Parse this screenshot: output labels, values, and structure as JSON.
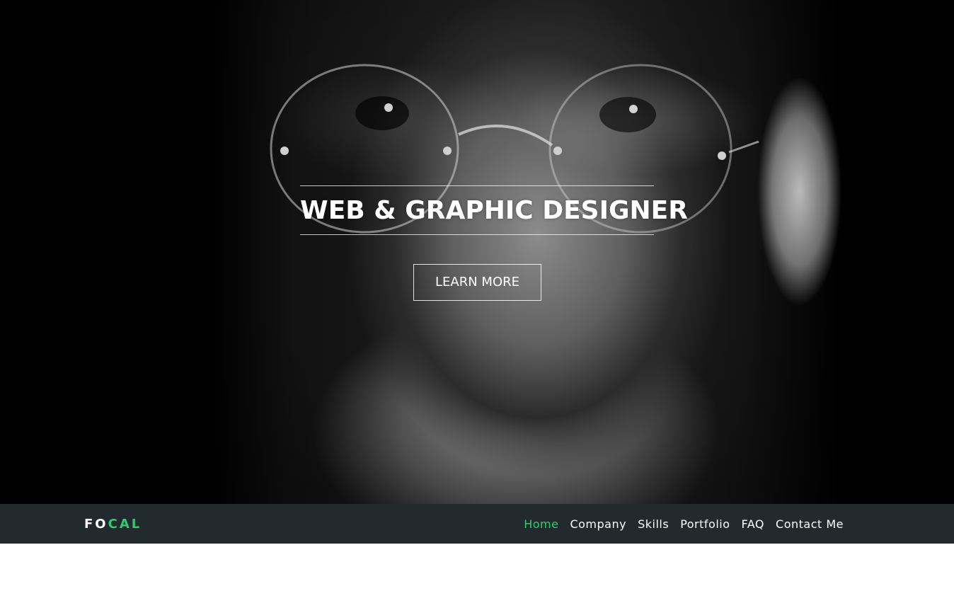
{
  "hero": {
    "headline": "WEB & GRAPHIC DESIGNER",
    "button_label": "LEARN MORE"
  },
  "navbar": {
    "brand_part1": "FO",
    "brand_part2": "CAL",
    "items": [
      {
        "label": "Home",
        "active": true
      },
      {
        "label": "Company",
        "active": false
      },
      {
        "label": "Skills",
        "active": false
      },
      {
        "label": "Portfolio",
        "active": false
      },
      {
        "label": "FAQ",
        "active": false
      },
      {
        "label": "Contact  Me",
        "active": false
      }
    ]
  },
  "colors": {
    "accent": "#2ecc71",
    "navbar_bg": "#232a2d",
    "hero_bg": "#000000",
    "text": "#ffffff"
  }
}
